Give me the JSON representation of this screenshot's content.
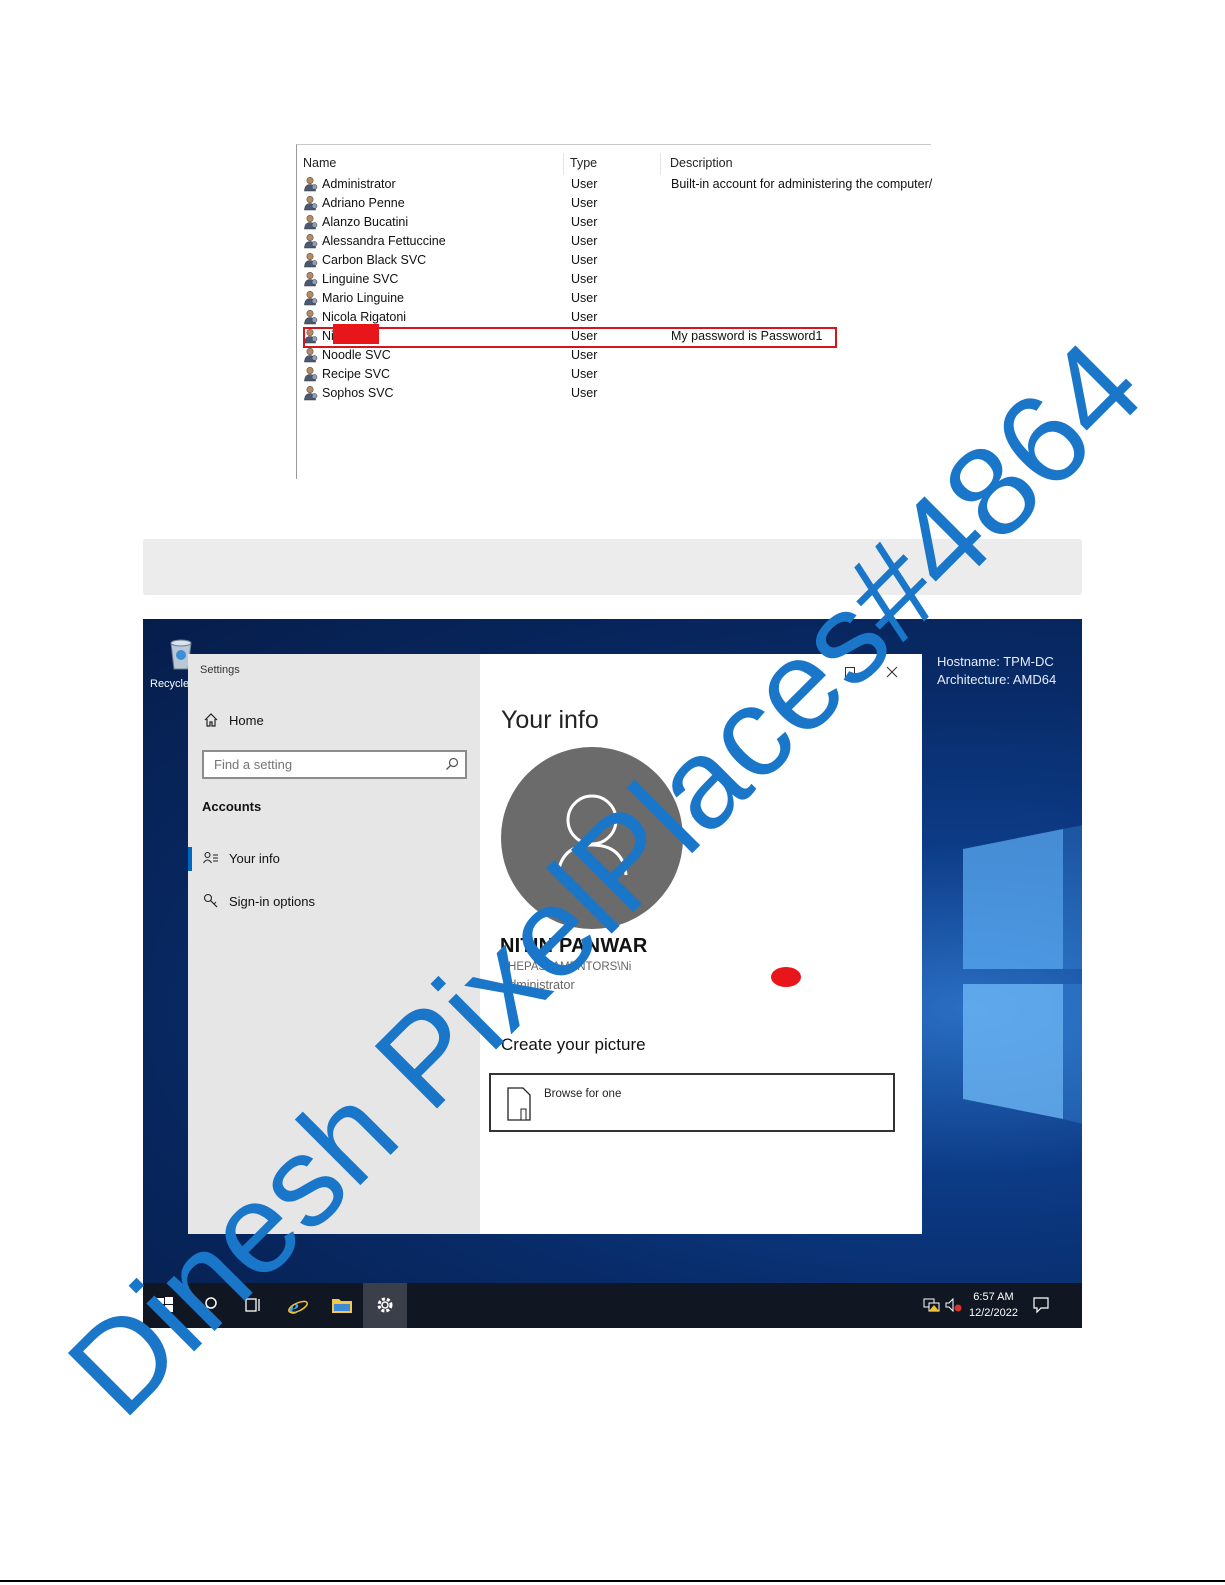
{
  "user_list": {
    "headers": {
      "name": "Name",
      "type": "Type",
      "description": "Description"
    },
    "rows": [
      {
        "name": "Administrator",
        "type": "User",
        "description": "Built-in account for administering the computer/"
      },
      {
        "name": "Adriano Penne",
        "type": "User",
        "description": ""
      },
      {
        "name": "Alanzo Bucatini",
        "type": "User",
        "description": ""
      },
      {
        "name": "Alessandra Fettuccine",
        "type": "User",
        "description": ""
      },
      {
        "name": "Carbon Black SVC",
        "type": "User",
        "description": ""
      },
      {
        "name": "Linguine SVC",
        "type": "User",
        "description": ""
      },
      {
        "name": "Mario Linguine",
        "type": "User",
        "description": ""
      },
      {
        "name": "Nicola Rigatoni",
        "type": "User",
        "description": ""
      },
      {
        "name": "Nit        ar",
        "type": "User",
        "description": "My password is Password1"
      },
      {
        "name": "Noodle SVC",
        "type": "User",
        "description": ""
      },
      {
        "name": "Recipe SVC",
        "type": "User",
        "description": ""
      },
      {
        "name": "Sophos SVC",
        "type": "User",
        "description": ""
      }
    ],
    "highlight_color": "#d4161c",
    "redaction_color": "#e8151b"
  },
  "desktop": {
    "recycle_label": "Recycle",
    "bg_info": {
      "hostname": "Hostname: TPM-DC",
      "architecture": "Architecture: AMD64"
    },
    "settings": {
      "title": "Settings",
      "home_label": "Home",
      "search_placeholder": "Find a setting",
      "section": "Accounts",
      "nav": [
        {
          "label": "Your info",
          "icon": "person-list-icon",
          "active": true
        },
        {
          "label": "Sign-in options",
          "icon": "key-icon",
          "active": false
        }
      ],
      "page_title": "Your info",
      "user_name": "NITIN PANWAR",
      "user_domain": "THEPASTAMENTORS\\Ni",
      "user_role": "Administrator",
      "picture_heading": "Create your picture",
      "browse_label": "Browse for one",
      "accent": "#0067c0"
    },
    "taskbar": {
      "time": "6:57 AM",
      "date": "12/2/2022"
    }
  },
  "watermark": "Dinesh PixelPlaces#4864"
}
